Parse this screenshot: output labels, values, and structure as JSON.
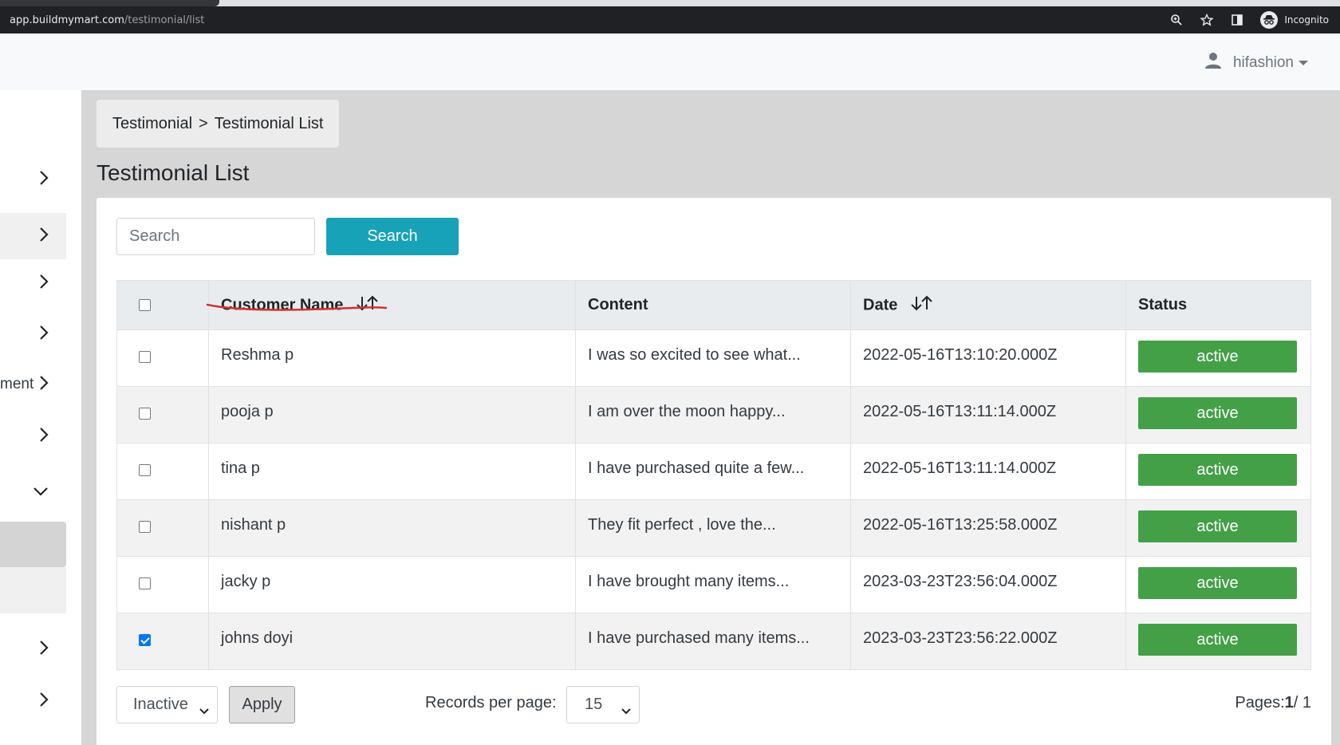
{
  "browser": {
    "url_host": "app.buildmymart.com",
    "url_path": "/testimonial/list",
    "incognito_label": "Incognito"
  },
  "header": {
    "user_name": "hifashion"
  },
  "sidebar": {
    "partial_label": "ment"
  },
  "breadcrumb": {
    "parent": "Testimonial",
    "separator": ">",
    "current": "Testimonial List"
  },
  "page": {
    "title": "Testimonial List"
  },
  "search": {
    "placeholder": "Search",
    "button_label": "Search"
  },
  "table": {
    "columns": [
      "Customer Name",
      "Content",
      "Date",
      "Status"
    ],
    "rows": [
      {
        "name": "Reshma p",
        "content": "I was so excited to see what...",
        "date": "2022-05-16T13:10:20.000Z",
        "status": "active",
        "checked": false
      },
      {
        "name": "pooja p",
        "content": "I am over the moon happy...",
        "date": "2022-05-16T13:11:14.000Z",
        "status": "active",
        "checked": false
      },
      {
        "name": "tina p",
        "content": "I have purchased quite a few...",
        "date": "2022-05-16T13:11:14.000Z",
        "status": "active",
        "checked": false
      },
      {
        "name": "nishant p",
        "content": "They fit perfect , love the...",
        "date": "2022-05-16T13:25:58.000Z",
        "status": "active",
        "checked": false
      },
      {
        "name": "jacky p",
        "content": "I have brought many items...",
        "date": "2023-03-23T23:56:04.000Z",
        "status": "active",
        "checked": false
      },
      {
        "name": "johns doyi",
        "content": "I have purchased many items...",
        "date": "2023-03-23T23:56:22.000Z",
        "status": "active",
        "checked": true
      }
    ]
  },
  "footer": {
    "bulk_action": "Inactive",
    "apply_label": "Apply",
    "records_label": "Records per page:",
    "records_value": "15",
    "pages_prefix": "Pages:",
    "current_page": "1",
    "total_pages": "/ 1"
  },
  "colors": {
    "accent": "#17a2b8",
    "status_active": "#43a047",
    "annotation": "#d32f2f"
  }
}
